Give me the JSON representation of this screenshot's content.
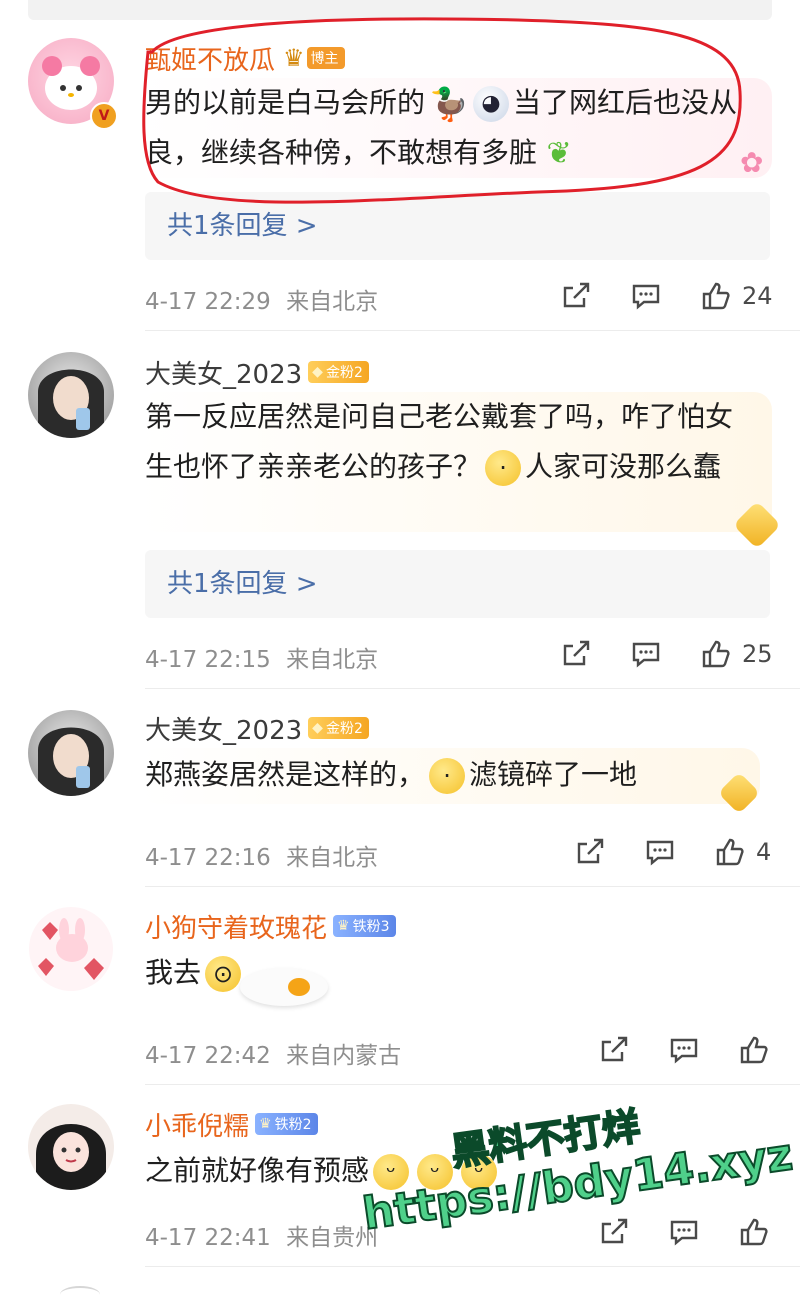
{
  "comments": [
    {
      "username": "甄姬不放瓜",
      "badge": "博主",
      "text_parts": [
        "男的以前是白马会所的",
        "当了网红后也没从良，继续各种傍，不敢想有多脏"
      ],
      "reply_link": "共1条回复 >",
      "time": "4-17 22:29",
      "location": "来自北京",
      "likes": "24"
    },
    {
      "username": "大美女_2023",
      "badge": "金粉2",
      "text_parts": [
        "第一反应居然是问自己老公戴套了吗，咋了怕女生也怀了亲亲老公的孩子？",
        "人家可没那么蠢"
      ],
      "reply_link": "共1条回复 >",
      "time": "4-17 22:15",
      "location": "来自北京",
      "likes": "25"
    },
    {
      "username": "大美女_2023",
      "badge": "金粉2",
      "text_parts": [
        "郑燕姿居然是这样的，",
        "滤镜碎了一地"
      ],
      "time": "4-17 22:16",
      "location": "来自北京",
      "likes": "4"
    },
    {
      "username": "小狗守着玫瑰花",
      "badge": "铁粉3",
      "text_parts": [
        "我去"
      ],
      "time": "4-17 22:42",
      "location": "来自内蒙古"
    },
    {
      "username": "小乖倪糯",
      "badge": "铁粉2",
      "text_parts": [
        "之前就好像有预感"
      ],
      "time": "4-17 22:41",
      "location": "来自贵州"
    }
  ],
  "watermark": {
    "line1": "黑料不打烊",
    "line2": "https://bdy14.xyz"
  },
  "icons": {
    "share": "share-icon",
    "comment": "comment-icon",
    "like": "thumbs-up-icon",
    "vip": "verified-v-icon"
  },
  "colors": {
    "name_orange": "#e8651c",
    "reply_blue": "#4a6ea8",
    "annotation_red": "#e0202a",
    "watermark_green": "#4fd08a"
  }
}
